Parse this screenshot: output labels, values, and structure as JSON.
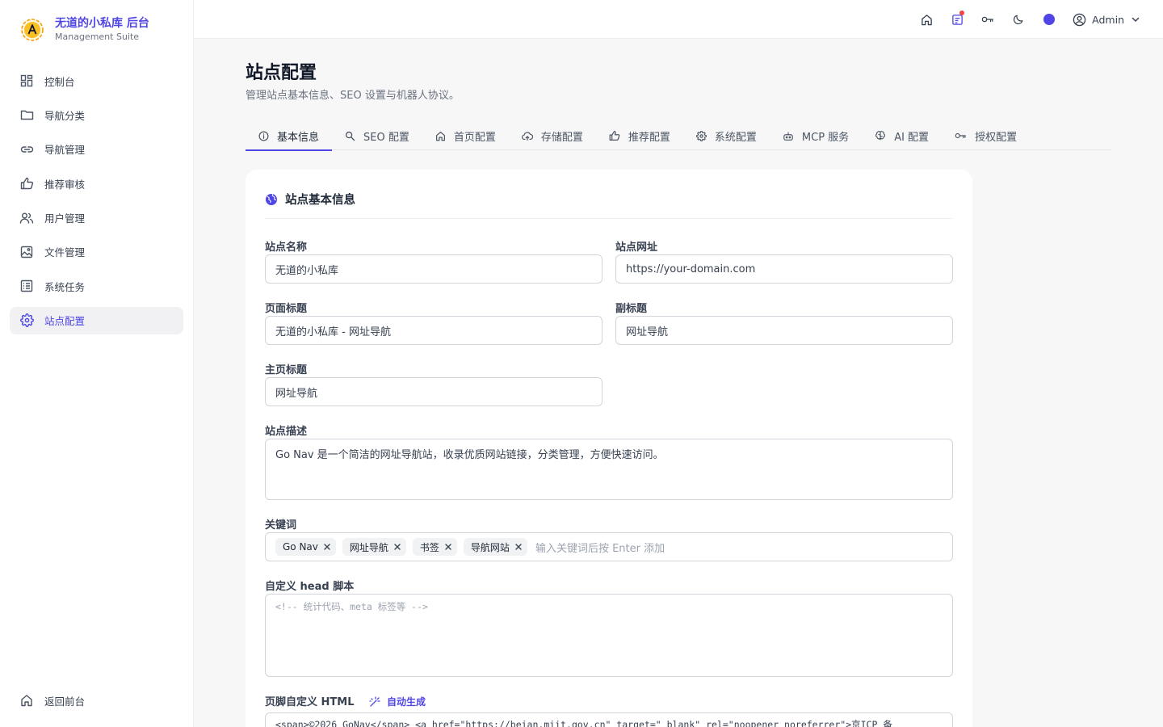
{
  "brand": {
    "title": "无道的小私库 后台",
    "subtitle": "Management Suite",
    "logo_icon": "a-badge-icon"
  },
  "sidebar": {
    "items": [
      {
        "label": "控制台",
        "icon": "dashboard-icon"
      },
      {
        "label": "导航分类",
        "icon": "folder-icon"
      },
      {
        "label": "导航管理",
        "icon": "link-icon"
      },
      {
        "label": "推荐审核",
        "icon": "thumbs-up-icon"
      },
      {
        "label": "用户管理",
        "icon": "users-icon"
      },
      {
        "label": "文件管理",
        "icon": "image-icon"
      },
      {
        "label": "系统任务",
        "icon": "list-icon"
      },
      {
        "label": "站点配置",
        "icon": "gear-icon",
        "active": true
      }
    ],
    "bottom": {
      "label": "返回前台",
      "icon": "home-icon"
    }
  },
  "topbar": {
    "icons": [
      "home-icon",
      "notification-icon",
      "key-icon",
      "moon-icon",
      "theme-color-dot"
    ],
    "accent": "#4f46e5",
    "notification_dot_color": "#ef4444",
    "user": "Admin"
  },
  "page": {
    "title": "站点配置",
    "description": "管理站点基本信息、SEO 设置与机器人协议。"
  },
  "tabs": [
    {
      "label": "基本信息",
      "icon": "info-icon",
      "active": true
    },
    {
      "label": "SEO 配置",
      "icon": "search-icon"
    },
    {
      "label": "首页配置",
      "icon": "home-icon"
    },
    {
      "label": "存储配置",
      "icon": "cloud-upload-icon"
    },
    {
      "label": "推荐配置",
      "icon": "thumbs-up-icon"
    },
    {
      "label": "系统配置",
      "icon": "gear-icon"
    },
    {
      "label": "MCP 服务",
      "icon": "robot-icon"
    },
    {
      "label": "AI 配置",
      "icon": "ai-brain-icon"
    },
    {
      "label": "授权配置",
      "icon": "key-icon"
    }
  ],
  "card": {
    "title": "站点基本信息",
    "icon": "globe-icon",
    "fields": {
      "site_name": {
        "label": "站点名称",
        "value": "无道的小私库"
      },
      "site_url": {
        "label": "站点网址",
        "value": "https://your-domain.com"
      },
      "page_title": {
        "label": "页面标题",
        "value": "无道的小私库 - 网址导航"
      },
      "subtitle": {
        "label": "副标题",
        "value": "网址导航"
      },
      "home_title": {
        "label": "主页标题",
        "value": "网址导航"
      },
      "description": {
        "label": "站点描述",
        "value": "Go Nav 是一个简洁的网址导航站，收录优质网站链接，分类管理，方便快速访问。"
      },
      "keywords": {
        "label": "关键词",
        "tags": [
          "Go Nav",
          "网址导航",
          "书签",
          "导航网站"
        ],
        "placeholder": "输入关键词后按 Enter 添加"
      },
      "head_script": {
        "label": "自定义 head 脚本",
        "placeholder": "<!-- 统计代码、meta 标签等 -->"
      },
      "footer_html": {
        "label": "页脚自定义 HTML",
        "auto_label": "自动生成",
        "value": "<span>©2026 GoNav</span> <a href=\"https://beian.miit.gov.cn\" target=\"_blank\" rel=\"noopener noreferrer\">京ICP 备"
      }
    }
  }
}
